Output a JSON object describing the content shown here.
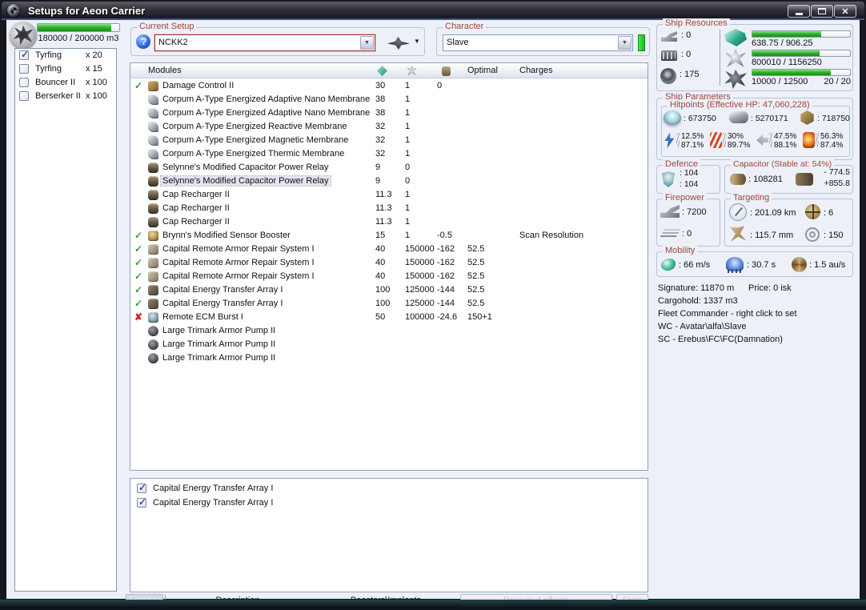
{
  "window": {
    "title": "Setups for Aeon Carrier",
    "controls": [
      "minimize-icon",
      "maximize-icon",
      "close-icon"
    ]
  },
  "sidebar": {
    "capacity_text": "180000 / 200000 m3",
    "capacity_pct": 90,
    "items": [
      {
        "name": "Tyrfing",
        "qty": "x 20",
        "state": "checked"
      },
      {
        "name": "Tyrfing",
        "qty": "x 15",
        "state": ""
      },
      {
        "name": "Bouncer II",
        "qty": "x 100",
        "state": ""
      },
      {
        "name": "Berserker II",
        "qty": "x 100",
        "state": ""
      }
    ]
  },
  "setup": {
    "label": "Current Setup",
    "value": "NCKK2"
  },
  "character": {
    "label": "Character",
    "value": "Slave"
  },
  "modules": {
    "title": "Modules",
    "col_optimal": "Optimal",
    "col_charges": "Charges",
    "rows": [
      {
        "mark": "ok",
        "icon": "dcu",
        "sel": "",
        "name": "Damage Control II",
        "cpu": "30",
        "pg": "1",
        "cap": "0",
        "opt": "",
        "chg": ""
      },
      {
        "mark": "",
        "icon": "plate",
        "sel": "",
        "name": "Corpum A-Type Energized Adaptive Nano Membrane",
        "cpu": "38",
        "pg": "1",
        "cap": "",
        "opt": "",
        "chg": ""
      },
      {
        "mark": "",
        "icon": "plate",
        "sel": "",
        "name": "Corpum A-Type Energized Adaptive Nano Membrane",
        "cpu": "38",
        "pg": "1",
        "cap": "",
        "opt": "",
        "chg": ""
      },
      {
        "mark": "",
        "icon": "plate",
        "sel": "",
        "name": "Corpum A-Type Energized Reactive Membrane",
        "cpu": "32",
        "pg": "1",
        "cap": "",
        "opt": "",
        "chg": ""
      },
      {
        "mark": "",
        "icon": "plate",
        "sel": "",
        "name": "Corpum A-Type Energized Magnetic Membrane",
        "cpu": "32",
        "pg": "1",
        "cap": "",
        "opt": "",
        "chg": ""
      },
      {
        "mark": "",
        "icon": "plate",
        "sel": "",
        "name": "Corpum A-Type Energized Thermic Membrane",
        "cpu": "32",
        "pg": "1",
        "cap": "",
        "opt": "",
        "chg": ""
      },
      {
        "mark": "",
        "icon": "cap",
        "sel": "",
        "name": "Selynne's Modified Capacitor Power Relay",
        "cpu": "9",
        "pg": "0",
        "cap": "",
        "opt": "",
        "chg": ""
      },
      {
        "mark": "",
        "icon": "cap",
        "sel": "selected",
        "name": "Selynne's Modified Capacitor Power Relay",
        "cpu": "9",
        "pg": "0",
        "cap": "",
        "opt": "",
        "chg": ""
      },
      {
        "mark": "",
        "icon": "cap",
        "sel": "",
        "name": "Cap Recharger II",
        "cpu": "11.3",
        "pg": "1",
        "cap": "",
        "opt": "",
        "chg": ""
      },
      {
        "mark": "",
        "icon": "cap",
        "sel": "",
        "name": "Cap Recharger II",
        "cpu": "11.3",
        "pg": "1",
        "cap": "",
        "opt": "",
        "chg": ""
      },
      {
        "mark": "",
        "icon": "cap",
        "sel": "",
        "name": "Cap Recharger II",
        "cpu": "11.3",
        "pg": "1",
        "cap": "",
        "opt": "",
        "chg": ""
      },
      {
        "mark": "ok",
        "icon": "sensor",
        "sel": "",
        "name": "Brynn's Modified Sensor Booster",
        "cpu": "15",
        "pg": "1",
        "cap": "-0.5",
        "opt": "",
        "chg": "Scan Resolution"
      },
      {
        "mark": "ok",
        "icon": "rep",
        "sel": "",
        "name": "Capital Remote Armor Repair System I",
        "cpu": "40",
        "pg": "150000",
        "cap": "-162",
        "opt": "52.5",
        "chg": ""
      },
      {
        "mark": "ok",
        "icon": "rep",
        "sel": "",
        "name": "Capital Remote Armor Repair System I",
        "cpu": "40",
        "pg": "150000",
        "cap": "-162",
        "opt": "52.5",
        "chg": ""
      },
      {
        "mark": "ok",
        "icon": "rep",
        "sel": "",
        "name": "Capital Remote Armor Repair System I",
        "cpu": "40",
        "pg": "150000",
        "cap": "-162",
        "opt": "52.5",
        "chg": ""
      },
      {
        "mark": "ok",
        "icon": "xfer",
        "sel": "",
        "name": "Capital Energy Transfer Array I",
        "cpu": "100",
        "pg": "125000",
        "cap": "-144",
        "opt": "52.5",
        "chg": ""
      },
      {
        "mark": "ok",
        "icon": "xfer",
        "sel": "",
        "name": "Capital Energy Transfer Array I",
        "cpu": "100",
        "pg": "125000",
        "cap": "-144",
        "opt": "52.5",
        "chg": ""
      },
      {
        "mark": "fail",
        "icon": "ecm",
        "sel": "",
        "name": "Remote ECM Burst I",
        "cpu": "50",
        "pg": "100000",
        "cap": "-24.6",
        "opt": "150+1",
        "chg": ""
      },
      {
        "mark": "",
        "icon": "rig",
        "sel": "",
        "name": "Large Trimark Armor Pump II",
        "cpu": "",
        "pg": "",
        "cap": "",
        "opt": "",
        "chg": ""
      },
      {
        "mark": "",
        "icon": "rig",
        "sel": "",
        "name": "Large Trimark Armor Pump II",
        "cpu": "",
        "pg": "",
        "cap": "",
        "opt": "",
        "chg": ""
      },
      {
        "mark": "",
        "icon": "rig",
        "sel": "",
        "name": "Large Trimark Armor Pump II",
        "cpu": "",
        "pg": "",
        "cap": "",
        "opt": "",
        "chg": ""
      }
    ]
  },
  "selected_drones": {
    "items": [
      {
        "name": "Capital Energy Transfer Array I",
        "state": "checked"
      },
      {
        "name": "Capital Energy Transfer Array I",
        "state": "checked"
      }
    ]
  },
  "tabs": {
    "drones": "Drones",
    "description": "Description",
    "boosters": "Boosters\\Implants",
    "projected": "Projected effects",
    "stats": "Stats"
  },
  "resources": {
    "label": "Ship Resources",
    "turrets": ": 0",
    "launchers": ": 0",
    "rigs": ": 175",
    "cpu": {
      "text": "638.75 / 906.25",
      "pct": 70.5
    },
    "powergrid": {
      "text": "800010 / 1156250",
      "pct": 69.2
    },
    "dronebay": {
      "text": "10000 / 12500",
      "pct": 80,
      "count": "20 / 20"
    }
  },
  "parameters": {
    "label": "Ship Parameters",
    "hitpoints_label": "Hitpoints (Effective HP: 47,060,228)",
    "shield": ": 673750",
    "armor": ": 5270171",
    "hull": ": 718750",
    "resists": [
      {
        "type": "em",
        "top": "12.5%",
        "bottom": "87.1%"
      },
      {
        "type": "th",
        "top": "30%",
        "bottom": "89.7%"
      },
      {
        "type": "ki",
        "top": "47.5%",
        "bottom": "88.1%"
      },
      {
        "type": "ex",
        "top": "56.3%",
        "bottom": "87.4%"
      }
    ]
  },
  "defence": {
    "label": "Defence",
    "line1": ": 104",
    "line2": ": 104"
  },
  "capacitor": {
    "label": "Capacitor (Stable at: 54%)",
    "amount": ": 108281",
    "drain": "- 774.5",
    "recharge": "+855.8"
  },
  "firepower": {
    "label": "Firepower",
    "turret_dps": ": 7200",
    "missile_dps": ": 0"
  },
  "targeting": {
    "label": "Targeting",
    "range": ": 201.09 km",
    "max_targets": ": 6",
    "signature": ": 115.7 mm",
    "scan_res": ": 150"
  },
  "mobility": {
    "label": "Mobility",
    "speed": ": 66 m/s",
    "align": ": 30.7 s",
    "warp": ": 1.5 au/s"
  },
  "info": {
    "signature": "Signature: 11870 m",
    "price": "Price: 0 isk",
    "cargohold": "Cargohold: 1337 m3",
    "fleet": "Fleet Commander - right click to set",
    "wc": "WC - Avatar\\alfa\\Slave",
    "sc": "SC - Erebus\\FC\\FC(Damnation)"
  },
  "icons": {
    "window": [
      "app-icon",
      "minimize-icon",
      "maximize-icon",
      "close-icon"
    ],
    "sidebar": [
      "drone-bay-icon",
      "drone-checkbox"
    ],
    "setup_bar": [
      "help-icon",
      "combo-arrow-icon",
      "ship-menu-icon",
      "ship-menu-caret-icon"
    ],
    "module_columns": [
      "cpu-icon",
      "powergrid-icon",
      "capacitor-icon"
    ],
    "module_status": [
      "check-ok-icon",
      "fail-x-icon"
    ],
    "resources": [
      "turret-hardpoint-icon",
      "launcher-hardpoint-icon",
      "rig-slot-icon",
      "cpu-big-icon",
      "powergrid-big-icon",
      "dronebay-big-icon"
    ],
    "hitpoints": [
      "shield-icon",
      "armor-icon",
      "hull-icon",
      "em-resist-icon",
      "thermal-resist-icon",
      "kinetic-resist-icon",
      "explosive-resist-icon"
    ],
    "stats_panels": [
      "defence-shield-icon",
      "capacitor-cell-icon",
      "capacitor-battery-icon",
      "turret-dps-icon",
      "missile-dps-icon",
      "radar-range-icon",
      "max-targets-icon",
      "signature-radius-icon",
      "scan-resolution-icon",
      "speed-icon",
      "align-time-icon",
      "warp-speed-icon"
    ]
  },
  "colors": {
    "group_label": "#9e463a",
    "bar_fill_green": "#2db32d",
    "ok_green": "#2ea22e",
    "fail_red": "#cc2222",
    "character_ready_green": "#22dd22",
    "setup_combo_border_red": "#a23535",
    "selection_bg": "#e4e4ee",
    "content_bg": "#edf0f7",
    "titlebar_dark": "#2e2e38"
  }
}
